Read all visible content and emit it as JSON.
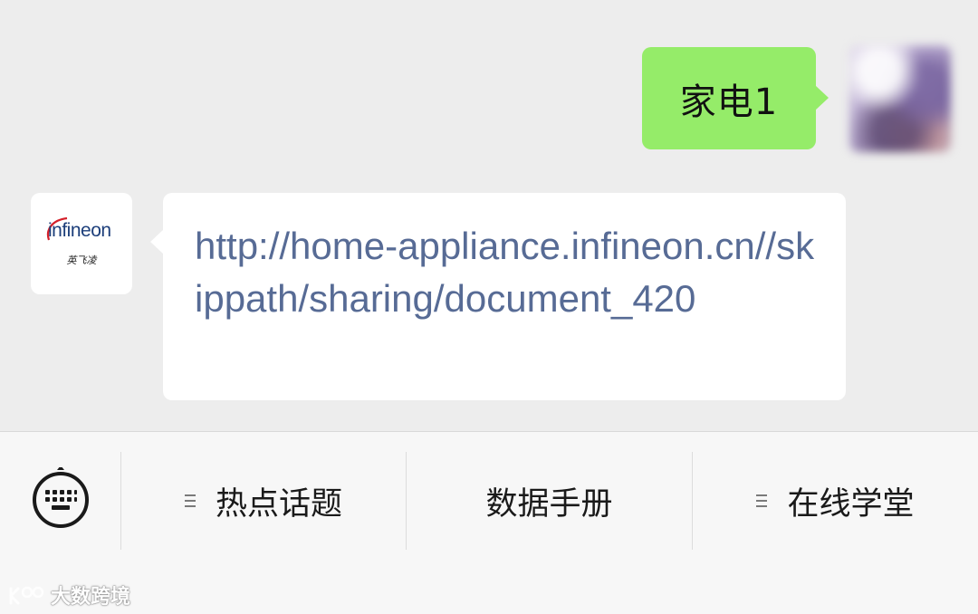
{
  "conversation": {
    "sent_message": "家电1",
    "received_message": "http://home-appliance.infineon.cn//skippath/sharing/document_420"
  },
  "bot": {
    "logo_text": "infineon",
    "logo_subtext": "英飞凌"
  },
  "menu": {
    "items": [
      {
        "label": "热点话题",
        "has_submenu": true
      },
      {
        "label": "数据手册",
        "has_submenu": false
      },
      {
        "label": "在线学堂",
        "has_submenu": true
      }
    ]
  },
  "watermark": {
    "text": "大数跨境"
  },
  "colors": {
    "sent_bubble": "#95ec69",
    "link": "#576b95",
    "chat_background": "#ededed",
    "logo_brand": "#1c3e7a"
  }
}
